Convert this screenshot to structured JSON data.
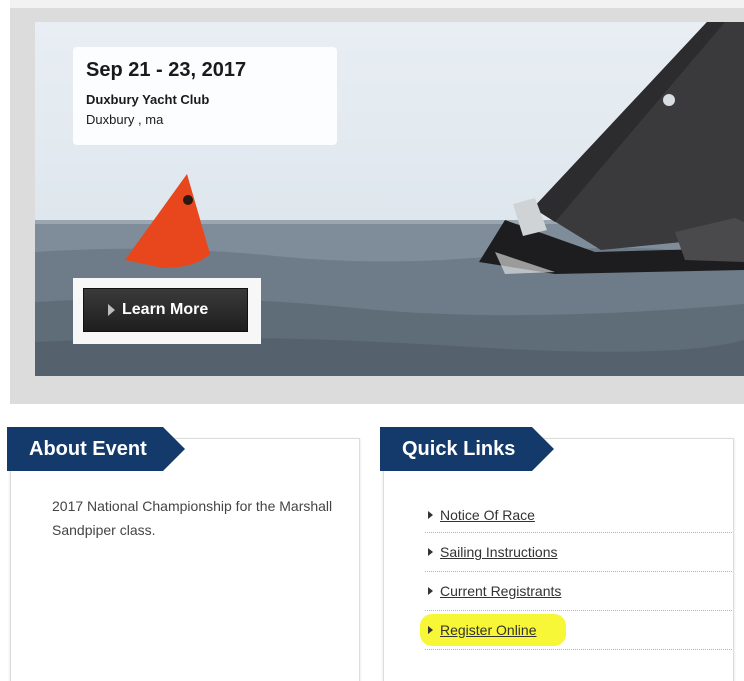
{
  "hero": {
    "date": "Sep 21 - 23, 2017",
    "venue": "Duxbury Yacht Club",
    "location": "Duxbury , ma",
    "learn_more_label": "Learn More"
  },
  "about": {
    "heading": "About Event",
    "description": "2017 National Championship for the Marshall Sandpiper class."
  },
  "quick_links": {
    "heading": "Quick Links",
    "items": [
      {
        "label": "Notice Of Race"
      },
      {
        "label": "Sailing Instructions"
      },
      {
        "label": "Current Registrants"
      },
      {
        "label": "Register Online",
        "highlighted": true
      }
    ]
  },
  "colors": {
    "ribbon": "#143a6b",
    "highlight": "#f7f52c",
    "button": "#222222"
  }
}
